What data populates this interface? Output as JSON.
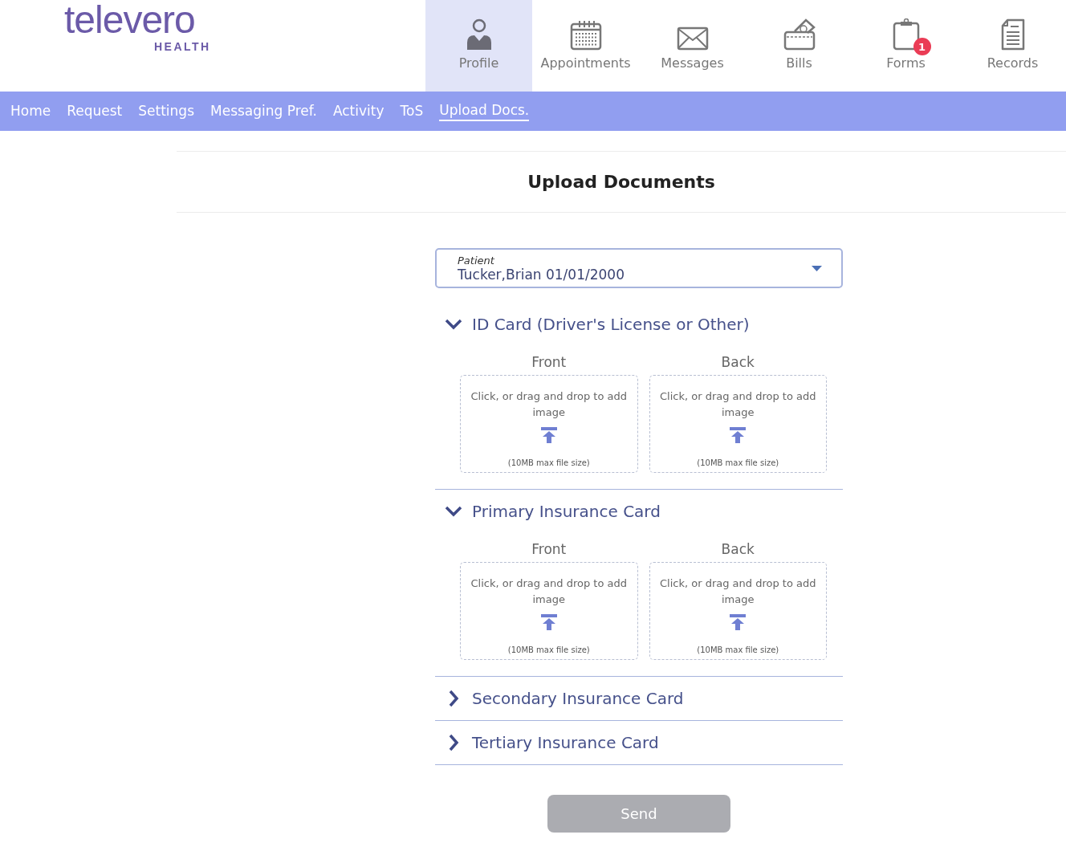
{
  "logo": {
    "name": "televero",
    "subtitle": "HEALTH"
  },
  "main_nav": [
    {
      "label": "Profile",
      "kind": "person",
      "selected": true
    },
    {
      "label": "Appointments",
      "kind": "calendar",
      "selected": false
    },
    {
      "label": "Messages",
      "kind": "envelope",
      "selected": false
    },
    {
      "label": "Bills",
      "kind": "wallet",
      "selected": false
    },
    {
      "label": "Forms",
      "kind": "clipboard",
      "selected": false,
      "badge": "1"
    },
    {
      "label": "Records",
      "kind": "document",
      "selected": false
    }
  ],
  "sub_nav": [
    {
      "label": "Home",
      "selected": false
    },
    {
      "label": "Request",
      "selected": false
    },
    {
      "label": "Settings",
      "selected": false
    },
    {
      "label": "Messaging Pref.",
      "selected": false
    },
    {
      "label": "Activity",
      "selected": false
    },
    {
      "label": "ToS",
      "selected": false
    },
    {
      "label": "Upload Docs.",
      "selected": true
    }
  ],
  "page_title": "Upload Documents",
  "patient_select": {
    "label": "Patient",
    "value": "Tucker,Brian 01/01/2000"
  },
  "sections": [
    {
      "title": "ID Card (Driver's License or Other)",
      "expanded": true,
      "sides": [
        {
          "label": "Front",
          "hint": "Click, or drag and drop to add image",
          "limit": "(10MB max file size)"
        },
        {
          "label": "Back",
          "hint": "Click, or drag and drop to add image",
          "limit": "(10MB max file size)"
        }
      ]
    },
    {
      "title": "Primary Insurance Card",
      "expanded": true,
      "sides": [
        {
          "label": "Front",
          "hint": "Click, or drag and drop to add image",
          "limit": "(10MB max file size)"
        },
        {
          "label": "Back",
          "hint": "Click, or drag and drop to add image",
          "limit": "(10MB max file size)"
        }
      ]
    },
    {
      "title": "Secondary Insurance Card",
      "expanded": false
    },
    {
      "title": "Tertiary Insurance Card",
      "expanded": false
    }
  ],
  "send_button": {
    "label": "Send",
    "disabled": true
  }
}
